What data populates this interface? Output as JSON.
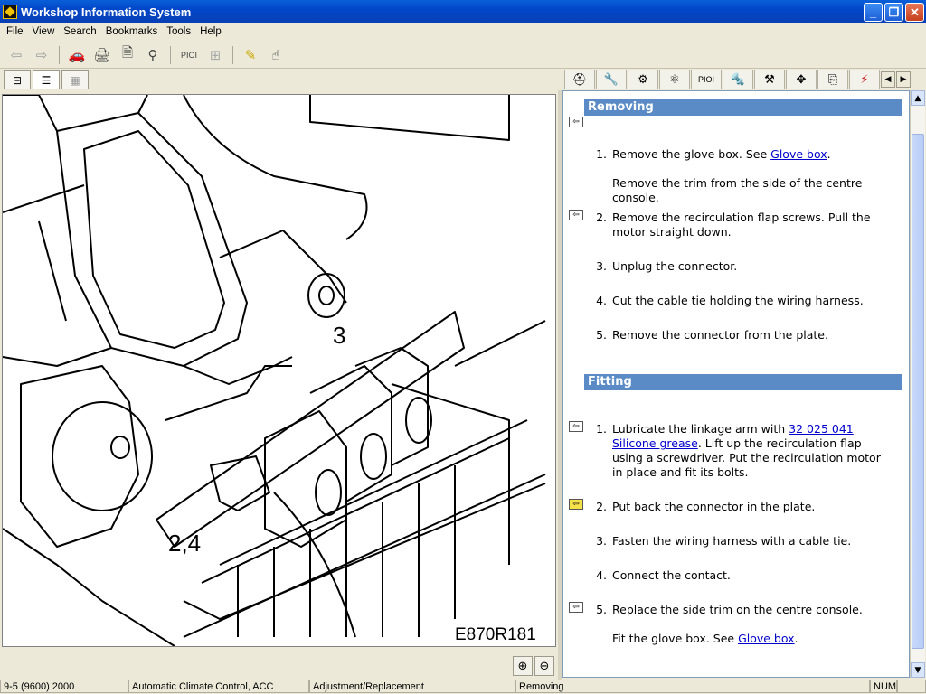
{
  "window": {
    "title": "Workshop Information System"
  },
  "menu": [
    "File",
    "View",
    "Search",
    "Bookmarks",
    "Tools",
    "Help"
  ],
  "toolbar": {
    "pioi_label": "PIOI"
  },
  "right_tabs": {
    "pioi_label": "PIOI"
  },
  "illustration": {
    "callouts": [
      "3",
      "2,4"
    ],
    "code": "E870R181"
  },
  "sections": [
    {
      "title": "Removing",
      "steps": [
        {
          "num": "1.",
          "parts": [
            "Remove the glove box. See ",
            "Glove box",
            "."
          ]
        },
        {
          "num": "",
          "parts": [
            "Remove the trim from the side of the centre console.",
            "",
            ""
          ]
        },
        {
          "num": "2.",
          "parts": [
            "Remove the recirculation flap screws. Pull the motor straight down.",
            "",
            ""
          ]
        },
        {
          "num": "3.",
          "parts": [
            "Unplug the connector.",
            "",
            ""
          ]
        },
        {
          "num": "4.",
          "parts": [
            "Cut the cable tie holding the wiring harness.",
            "",
            ""
          ]
        },
        {
          "num": "5.",
          "parts": [
            "Remove the connector from the plate.",
            "",
            ""
          ]
        }
      ]
    },
    {
      "title": "Fitting",
      "steps": [
        {
          "num": "1.",
          "parts": [
            "Lubricate the linkage arm with ",
            "32 025 041 Silicone grease",
            ". Lift up the recirculation flap using a screwdriver. Put the recirculation motor in place and fit its bolts."
          ]
        },
        {
          "num": "2.",
          "parts": [
            "Put back the connector in the plate.",
            "",
            ""
          ]
        },
        {
          "num": "3.",
          "parts": [
            "Fasten the wiring harness with a cable tie.",
            "",
            ""
          ]
        },
        {
          "num": "4.",
          "parts": [
            "Connect the contact.",
            "",
            ""
          ]
        },
        {
          "num": "5.",
          "parts": [
            "Replace the side trim on the centre console.",
            "",
            ""
          ]
        },
        {
          "num": "",
          "parts": [
            "Fit the glove box. See ",
            "Glove box",
            "."
          ]
        }
      ]
    }
  ],
  "status": {
    "vehicle": "9-5 (9600) 2000",
    "system": "Automatic Climate Control, ACC",
    "operation": "Adjustment/Replacement",
    "section": "Removing",
    "num": "NUM"
  }
}
